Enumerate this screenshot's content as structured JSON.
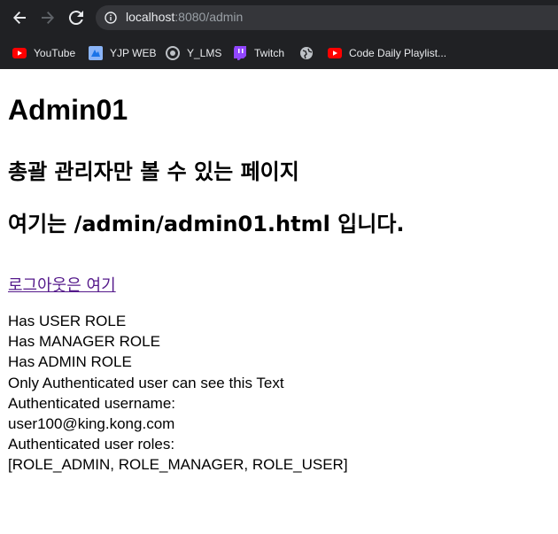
{
  "browser": {
    "url_host": "localhost",
    "url_rest": ":8080/admin",
    "bookmarks": [
      {
        "label": "YouTube",
        "icon": "youtube-icon"
      },
      {
        "label": "YJP WEB",
        "icon": "yjp-icon"
      },
      {
        "label": "Y_LMS",
        "icon": "lms-icon"
      },
      {
        "label": "Twitch",
        "icon": "twitch-icon"
      },
      {
        "label": "",
        "icon": "globe-icon"
      },
      {
        "label": "Code Daily Playlist...",
        "icon": "youtube-icon"
      }
    ]
  },
  "page": {
    "title": "Admin01",
    "subtitle1": "총괄 관리자만 볼 수 있는 페이지",
    "subtitle2": "여기는 /admin/admin01.html 입니다.",
    "logout_link": "로그아웃은 여기",
    "lines": [
      "Has USER ROLE",
      "Has MANAGER ROLE",
      "Has ADMIN ROLE",
      "Only Authenticated user can see this Text",
      "Authenticated username:",
      "user100@king.kong.com",
      "Authenticated user roles:",
      "[ROLE_ADMIN, ROLE_MANAGER, ROLE_USER]"
    ]
  },
  "colors": {
    "chrome_bg": "#202124",
    "omnibox_bg": "#35363a",
    "link_visited": "#551a8b",
    "youtube_red": "#ff0000",
    "twitch_purple": "#9146ff"
  }
}
